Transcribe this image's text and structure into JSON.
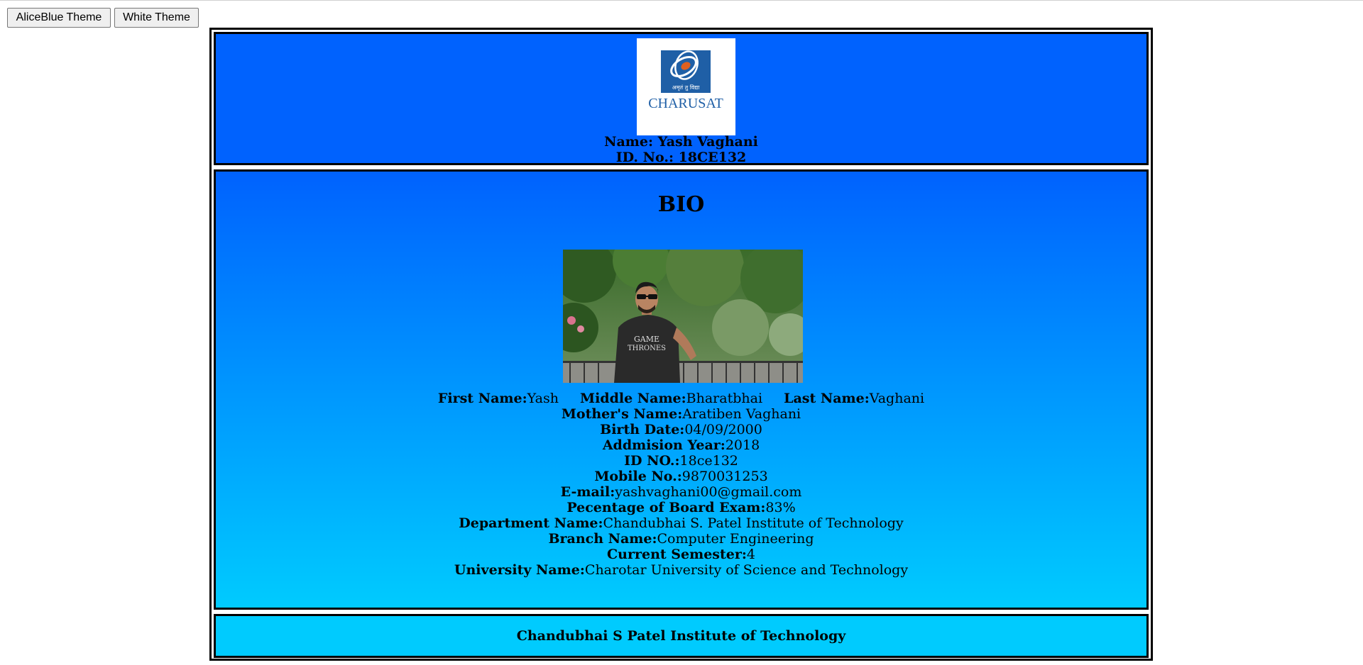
{
  "toolbar": {
    "aliceblue_label": "AliceBlue Theme",
    "white_label": "White Theme"
  },
  "header": {
    "logo": {
      "icon": "charusat-logo",
      "tagline": "अमृतं तु विद्या",
      "wordmark": "CHARUSAT"
    },
    "name_line": "Name: Yash Vaghani",
    "id_line": "ID. No.: 18CE132",
    "background": "#0062fe"
  },
  "bio": {
    "title": "BIO",
    "photo_icon": "profile-photo",
    "gradient_top": "#0062fe",
    "gradient_bottom": "#00cbfe",
    "first_name_label": "First Name:",
    "first_name": "Yash",
    "middle_name_label": "Middle Name:",
    "middle_name": "Bharatbhai",
    "last_name_label": "Last Name:",
    "last_name": "Vaghani",
    "fields": [
      {
        "label": "Mother's Name:",
        "value": "Aratiben Vaghani"
      },
      {
        "label": "Birth Date:",
        "value": "04/09/2000"
      },
      {
        "label": "Addmision Year:",
        "value": "2018"
      },
      {
        "label": "ID NO.:",
        "value": "18ce132"
      },
      {
        "label": "Mobile No.:",
        "value": "9870031253"
      },
      {
        "label": "E-mail:",
        "value": "yashvaghani00@gmail.com"
      },
      {
        "label": "Pecentage of Board Exam:",
        "value": "83%"
      },
      {
        "label": "Department Name:",
        "value": "Chandubhai S. Patel Institute of Technology"
      },
      {
        "label": "Branch Name:",
        "value": "Computer Engineering"
      },
      {
        "label": "Current Semester:",
        "value": "4"
      },
      {
        "label": "University Name:",
        "value": "Charotar University of Science and Technology"
      }
    ]
  },
  "footer": {
    "text": "Chandubhai S Patel Institute of Technology",
    "background": "#00cbfe"
  }
}
